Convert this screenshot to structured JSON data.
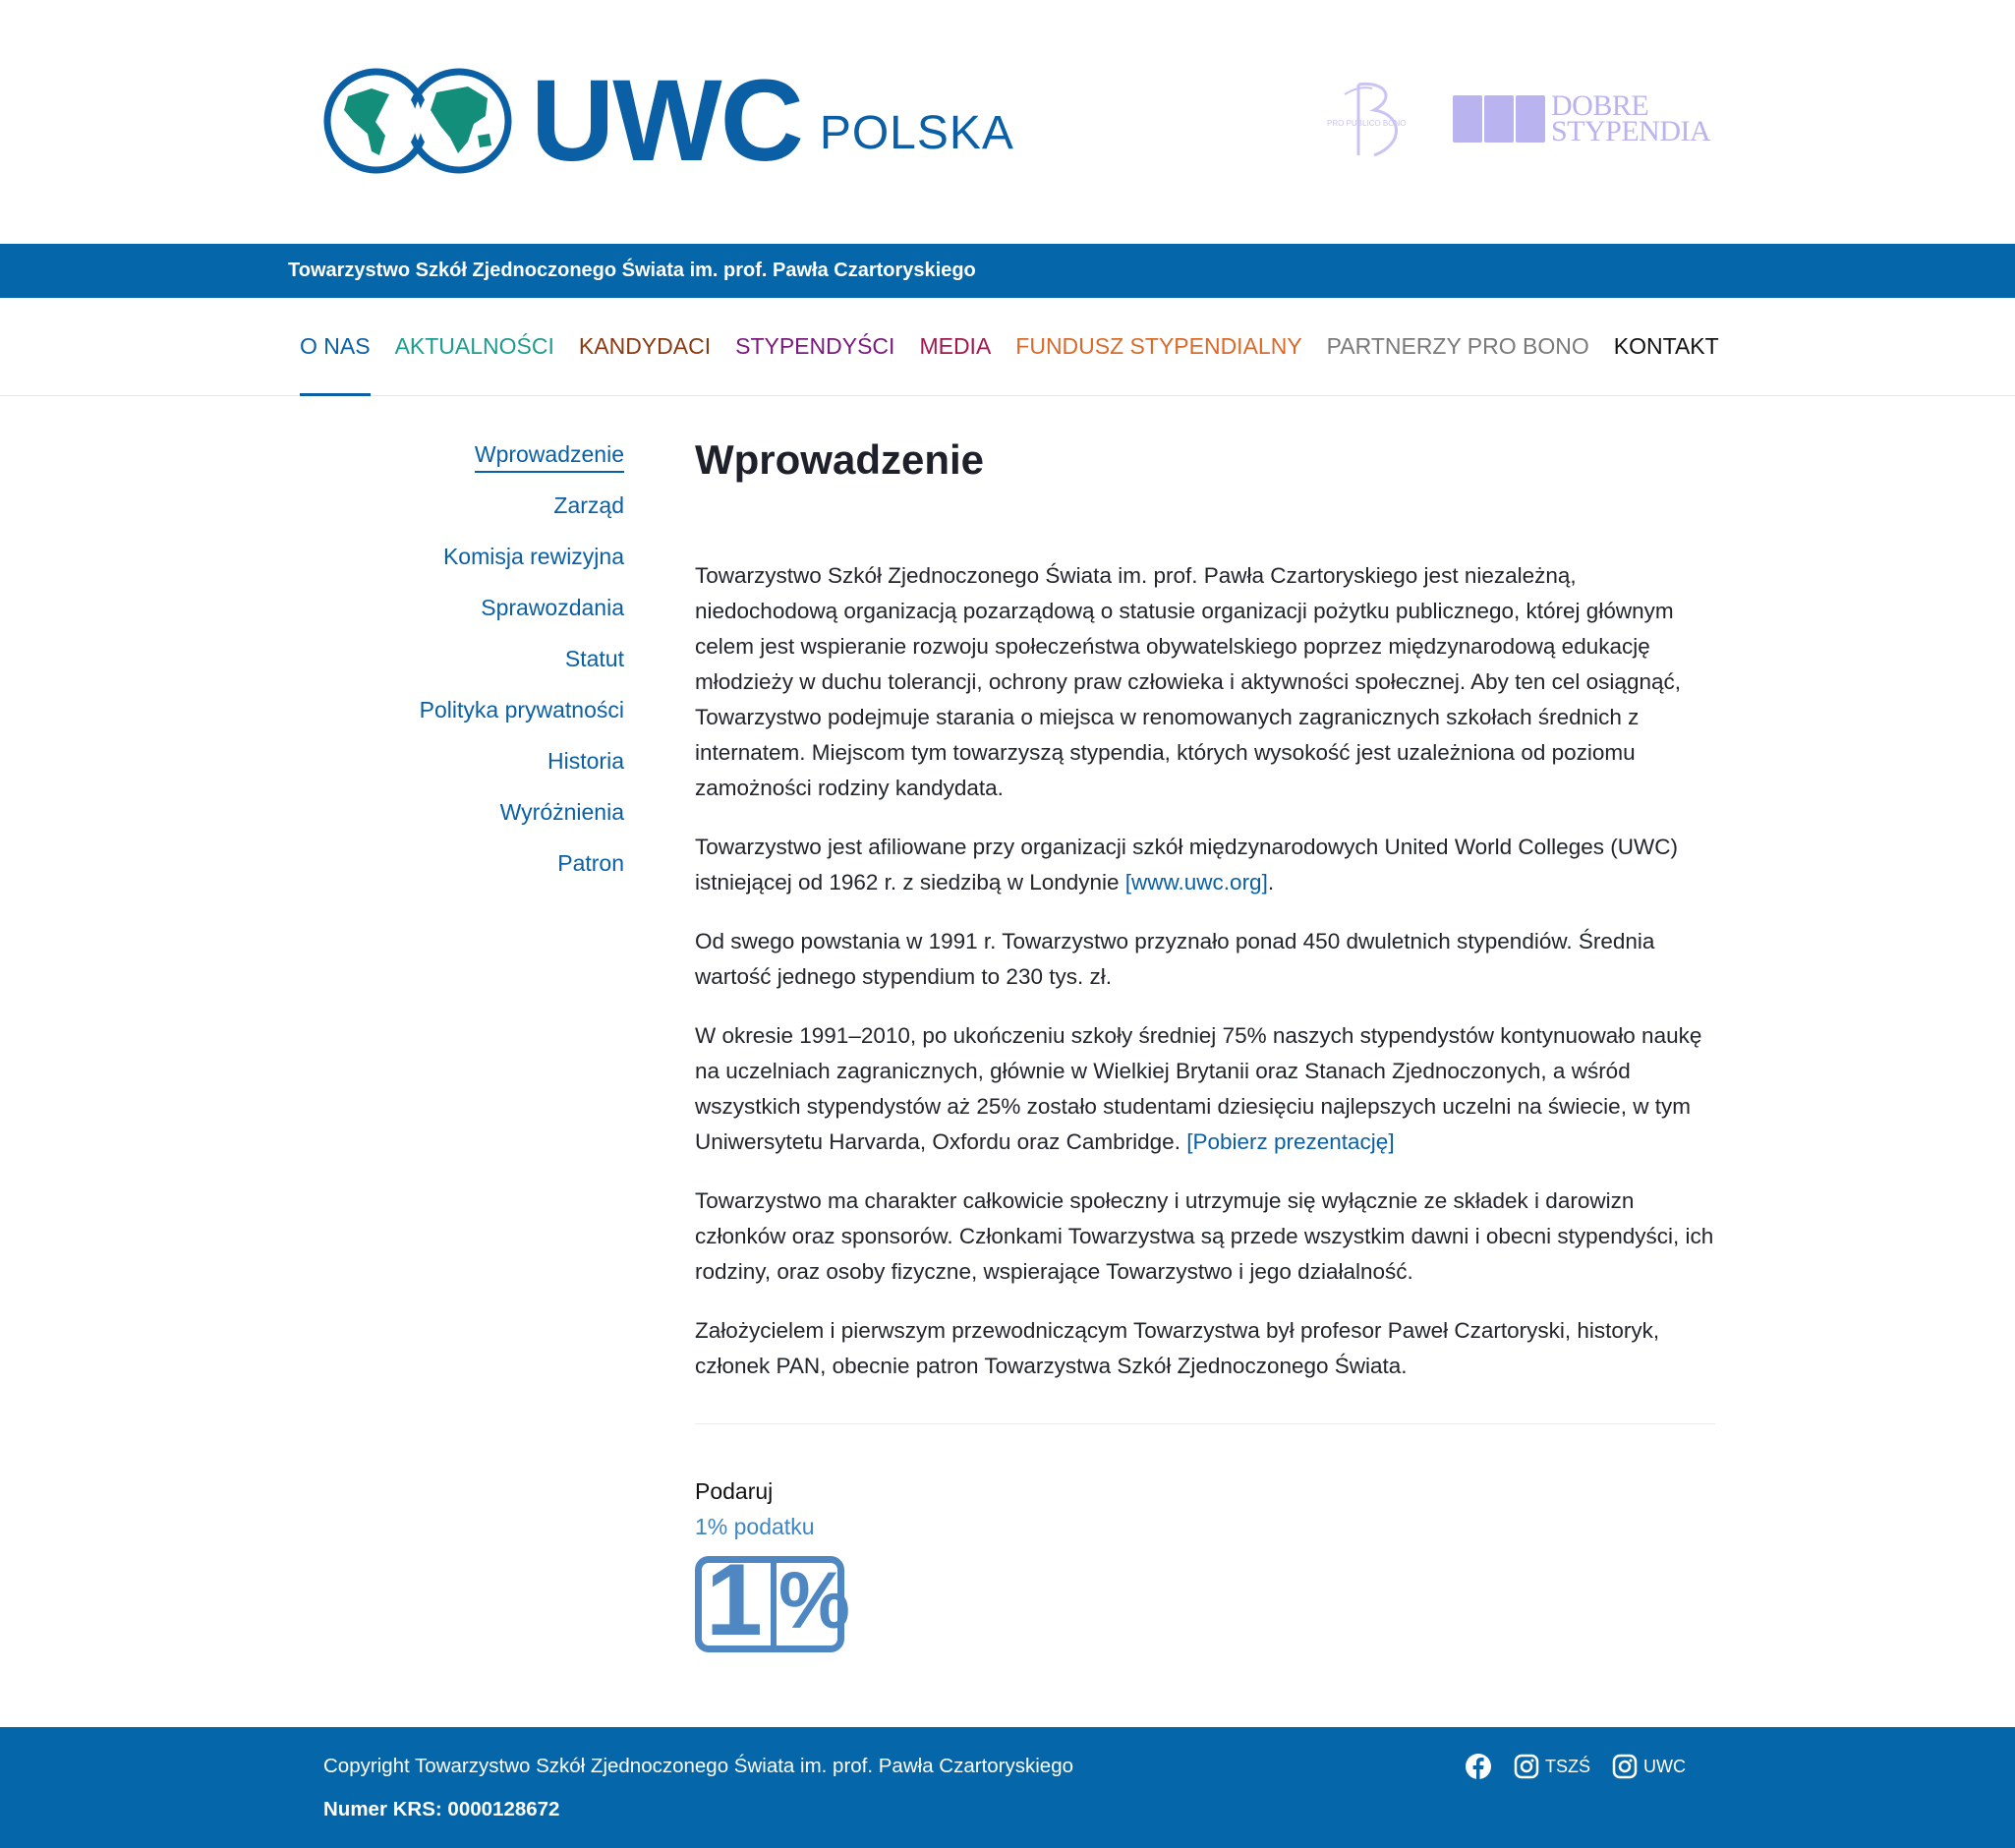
{
  "header": {
    "logo_main": "UWC",
    "logo_sub": "POLSKA",
    "partner_logo_1": "PRO PUBLICO BONO",
    "partner_logo_2_line1": "DOBRE",
    "partner_logo_2_line2": "STYPENDIA"
  },
  "bluebar": {
    "text": "Towarzystwo Szkół Zjednoczonego Świata im. prof. Pawła Czartoryskiego"
  },
  "nav": {
    "items": [
      {
        "label": "O NAS",
        "color": "#0b5fa5"
      },
      {
        "label": "AKTUALNOŚCI",
        "color": "#1f9b8f"
      },
      {
        "label": "KANDYDACI",
        "color": "#8a3a10"
      },
      {
        "label": "STYPENDYŚCI",
        "color": "#7a1a7d"
      },
      {
        "label": "MEDIA",
        "color": "#a3174f"
      },
      {
        "label": "FUNDUSZ STYPENDIALNY",
        "color": "#d96a2b"
      },
      {
        "label": "PARTNERZY PRO BONO",
        "color": "#7a7a7a"
      },
      {
        "label": "KONTAKT",
        "color": "#111111"
      }
    ]
  },
  "sidebar": {
    "items": [
      {
        "label": "Wprowadzenie"
      },
      {
        "label": "Zarząd"
      },
      {
        "label": "Komisja rewizyjna"
      },
      {
        "label": "Sprawozdania"
      },
      {
        "label": "Statut"
      },
      {
        "label": "Polityka prywatności"
      },
      {
        "label": "Historia"
      },
      {
        "label": "Wyróżnienia"
      },
      {
        "label": "Patron"
      }
    ]
  },
  "main": {
    "title": "Wprowadzenie",
    "p1": "Towarzystwo Szkół Zjednoczonego Świata im. prof. Pawła Czartoryskiego jest niezależną, niedochodową organizacją pozarządową o statusie organizacji pożytku publicznego, której głównym celem jest wspieranie rozwoju społeczeństwa obywatelskiego poprzez międzynarodową edukację młodzieży w duchu tolerancji, ochrony praw człowieka i aktywności społecznej. Aby ten cel osiągnąć, Towarzystwo podejmuje starania o miejsca w renomowanych zagranicznych szkołach średnich z internatem. Miejscom tym towarzyszą stypendia, których wysokość jest uzależniona od poziomu zamożności rodziny kandydata.",
    "p2": "Towarzystwo jest afiliowane przy organizacji szkół międzynarodowych United World Colleges (UWC) istniejącej od 1962 r. z siedzibą w Londynie ",
    "p2_link": "[www.uwc.org]",
    "p2_end": ".",
    "p3": "Od swego powstania w 1991 r. Towarzystwo przyznało ponad 450 dwuletnich stypendiów. Średnia wartość jednego stypendium to 230 tys. zł.",
    "p4": "W okresie 1991–2010, po ukończeniu szkoły średniej 75% naszych stypendystów kontynuowało naukę na uczelniach zagranicznych, głównie w Wielkiej Brytanii oraz Stanach Zjednoczonych, a wśród wszystkich stypendystów aż 25% zostało studentami dziesięciu najlepszych uczelni na świecie, w tym Uniwersytetu Harvarda, Oxfordu oraz Cambridge. ",
    "p4_link": "[Pobierz prezentację]",
    "p5": "Towarzystwo ma charakter całkowicie społeczny i utrzymuje się wyłącznie ze składek i darowizn członków oraz sponsorów. Członkami Towarzystwa są przede wszystkim dawni i obecni stypendyści, ich rodziny, oraz osoby fizyczne, wspierające Towarzystwo i jego działalność.",
    "p6": "Założycielem i pierwszym przewodniczącym Towarzystwa był profesor Paweł Czartoryski, historyk, członek PAN, obecnie patron Towarzystwa Szkół Zjednoczonego Świata."
  },
  "donate": {
    "label": "Podaruj",
    "sub": "1% podatku",
    "badge_one": "1",
    "badge_pct": "%"
  },
  "footer": {
    "copyright": "Copyright Towarzystwo Szkół Zjednoczonego Świata im. prof. Pawła Czartoryskiego",
    "krs": "Numer KRS: 0000128672",
    "social_1": "TSZŚ",
    "social_2": "UWC"
  }
}
